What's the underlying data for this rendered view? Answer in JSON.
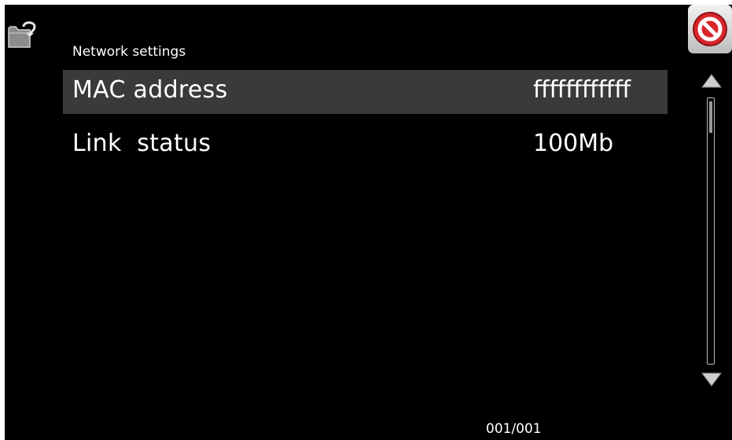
{
  "screen": {
    "title": "Network settings",
    "page_counter": "001/001"
  },
  "buttons": {
    "back_icon": "back-folder-icon",
    "close_icon": "no-entry-icon",
    "close_color": "#d8262b"
  },
  "settings": [
    {
      "label": "MAC address",
      "value": "ffffffffffff",
      "selected": true
    },
    {
      "label": "Link  status",
      "value": "100Mb",
      "selected": false
    }
  ],
  "scrollbar": {
    "up_icon": "triangle-up-icon",
    "down_icon": "triangle-down-icon"
  },
  "colors": {
    "background": "#000000",
    "selected_row": "#3a3a3a",
    "text": "#ffffff"
  }
}
